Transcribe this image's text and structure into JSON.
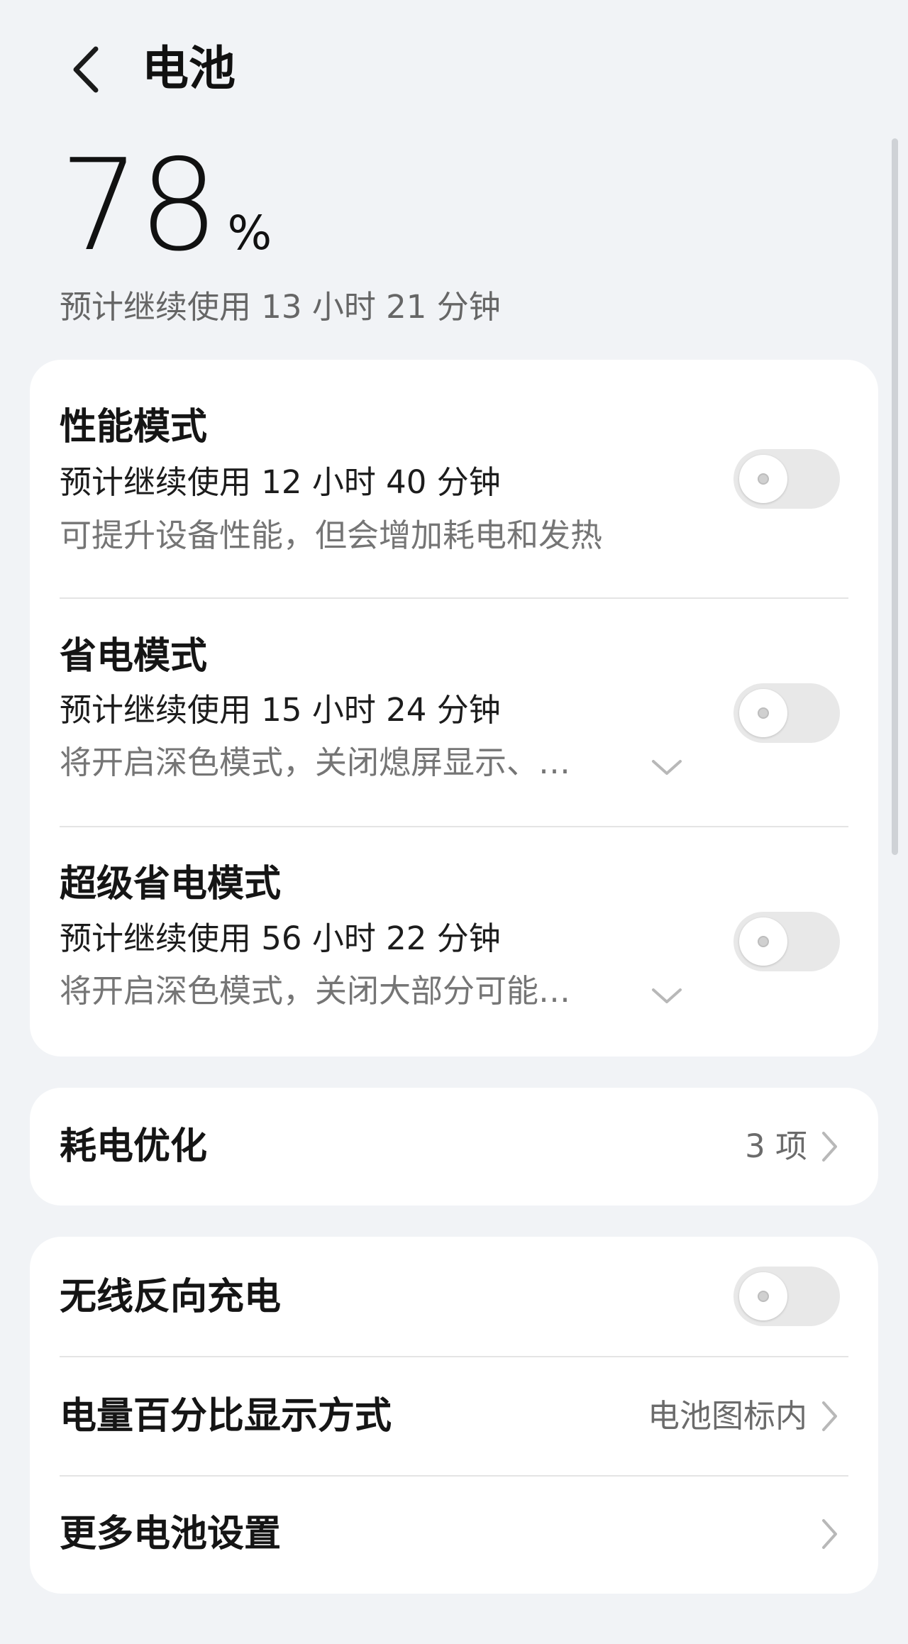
{
  "header": {
    "title": "电池"
  },
  "battery": {
    "percent": "78",
    "unit": "%",
    "remaining": "预计继续使用 13 小时 21 分钟"
  },
  "modes": [
    {
      "title": "性能模式",
      "time": "预计继续使用 12 小时 40 分钟",
      "desc": "可提升设备性能，但会增加耗电和发热",
      "enabled": false
    },
    {
      "title": "省电模式",
      "time": "预计继续使用 15 小时 24 分钟",
      "desc": "将开启深色模式，关闭熄屏显示、…",
      "enabled": false
    },
    {
      "title": "超级省电模式",
      "time": "预计继续使用 56 小时 22 分钟",
      "desc": "将开启深色模式，关闭大部分可能…",
      "enabled": false
    }
  ],
  "optimize": {
    "label": "耗电优化",
    "value": "3 项"
  },
  "settings": {
    "wireless_reverse": {
      "label": "无线反向充电",
      "enabled": false
    },
    "percent_display": {
      "label": "电量百分比显示方式",
      "value": "电池图标内"
    },
    "more": {
      "label": "更多电池设置"
    }
  },
  "icons": {
    "back": "back-arrow-icon",
    "chevron_right": "chevron-right-icon",
    "chevron_down": "chevron-down-icon"
  }
}
